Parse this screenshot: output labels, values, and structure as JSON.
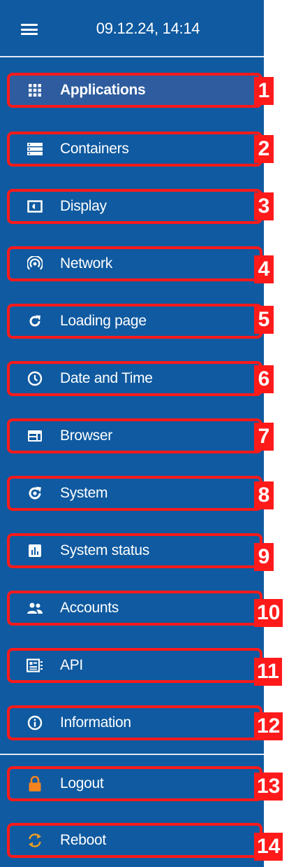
{
  "header": {
    "datetime": "09.12.24, 14:14"
  },
  "nav": {
    "items": [
      {
        "label": "Applications",
        "icon": "grid-icon",
        "badge": "1",
        "active": true
      },
      {
        "label": "Containers",
        "icon": "containers-icon",
        "badge": "2"
      },
      {
        "label": "Display",
        "icon": "display-icon",
        "badge": "3"
      },
      {
        "label": "Network",
        "icon": "network-icon",
        "badge": "4"
      },
      {
        "label": "Loading page",
        "icon": "reload-icon",
        "badge": "5"
      },
      {
        "label": "Date and Time",
        "icon": "clock-icon",
        "badge": "6"
      },
      {
        "label": "Browser",
        "icon": "browser-icon",
        "badge": "7"
      },
      {
        "label": "System",
        "icon": "system-icon",
        "badge": "8"
      },
      {
        "label": "System status",
        "icon": "status-chart-icon",
        "badge": "9"
      },
      {
        "label": "Accounts",
        "icon": "accounts-icon",
        "badge": "10"
      },
      {
        "label": "API",
        "icon": "api-icon",
        "badge": "11"
      },
      {
        "label": "Information",
        "icon": "info-icon",
        "badge": "12"
      },
      {
        "label": "Logout",
        "icon": "lock-icon",
        "badge": "13"
      },
      {
        "label": "Reboot",
        "icon": "reboot-icon",
        "badge": "14"
      }
    ]
  },
  "colors": {
    "sidebar_bg": "#0f5aa0",
    "active_bg": "#2e5c9e",
    "highlight_red": "#ff1a1a",
    "lock_orange": "#f5841f"
  }
}
